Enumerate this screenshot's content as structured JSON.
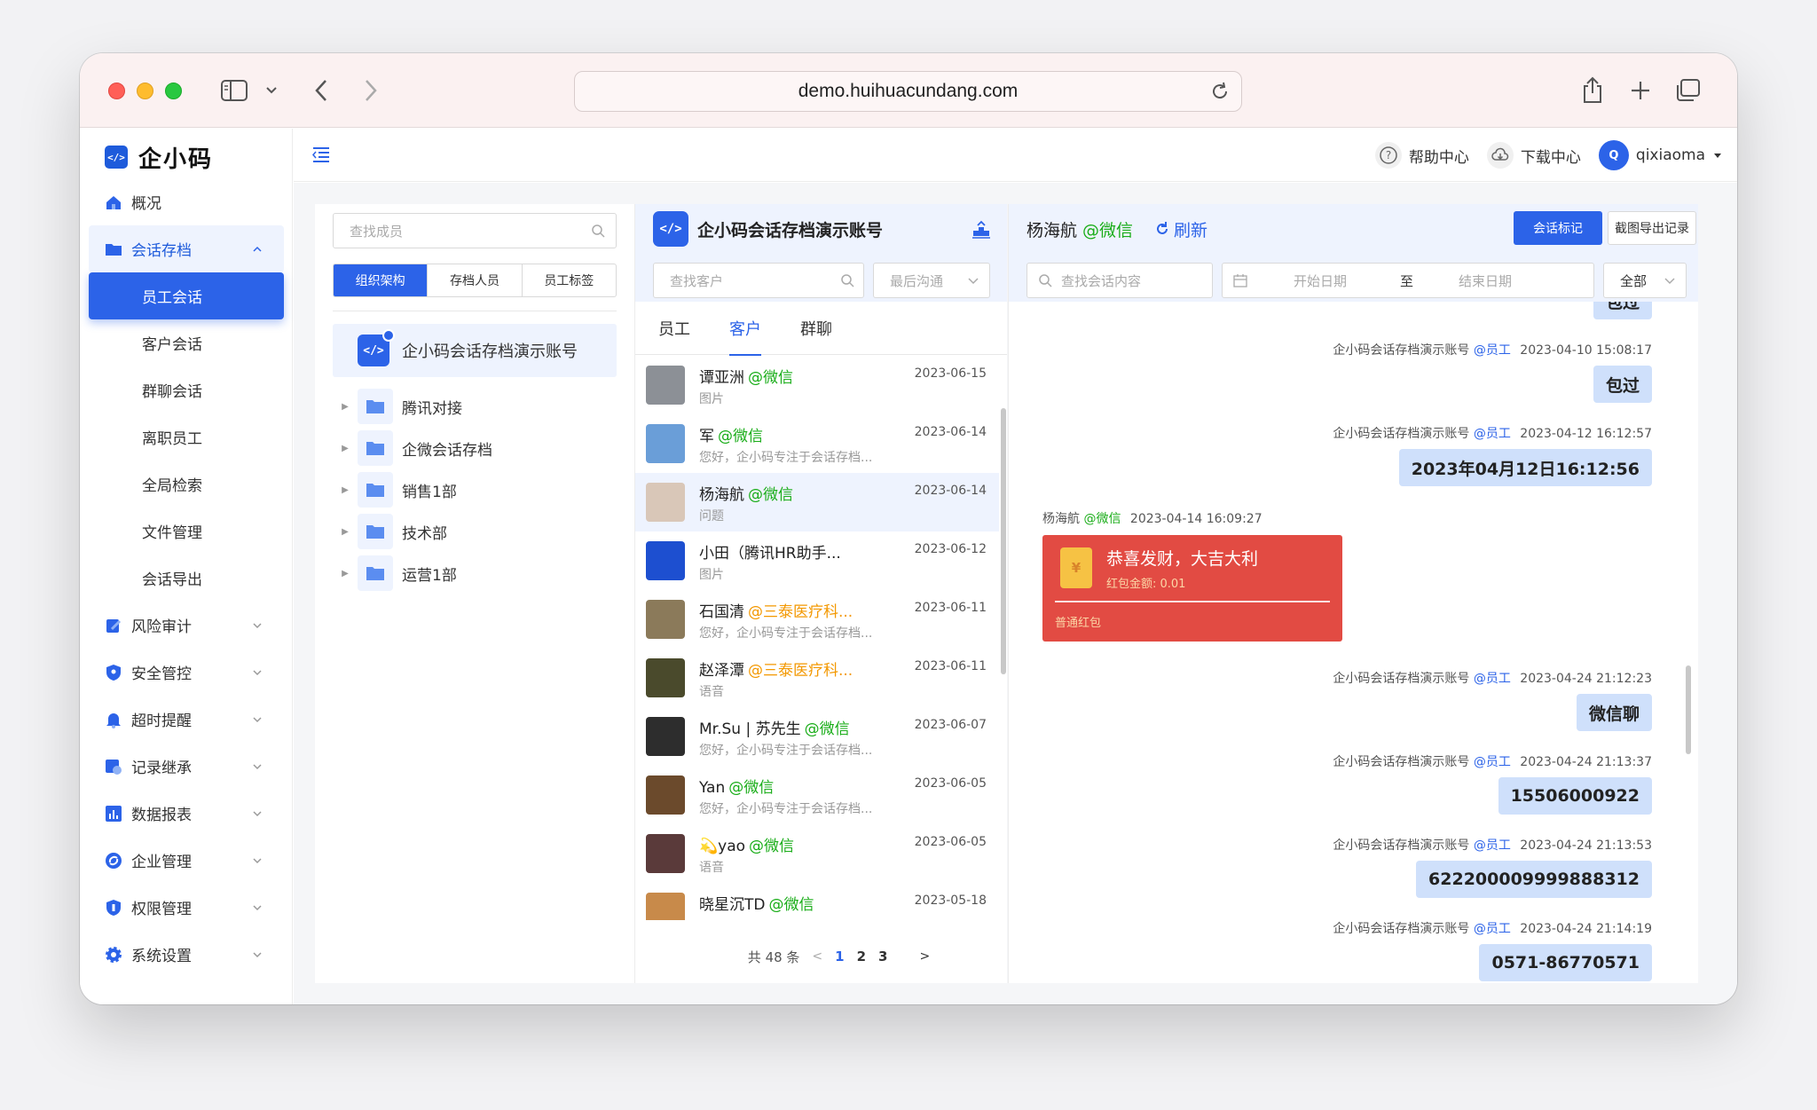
{
  "browser": {
    "url": "demo.huihuacundang.com"
  },
  "app": {
    "logo_text": "企小码"
  },
  "sidebar": {
    "items": [
      {
        "label": "概况",
        "icon": "home-icon"
      },
      {
        "label": "会话存档",
        "icon": "folder-icon",
        "open": true
      },
      {
        "label": "风险审计",
        "icon": "audit-icon"
      },
      {
        "label": "安全管控",
        "icon": "shield-icon"
      },
      {
        "label": "超时提醒",
        "icon": "bell-icon"
      },
      {
        "label": "记录继承",
        "icon": "inherit-icon"
      },
      {
        "label": "数据报表",
        "icon": "chart-icon"
      },
      {
        "label": "企业管理",
        "icon": "enterprise-icon"
      },
      {
        "label": "权限管理",
        "icon": "permission-icon"
      },
      {
        "label": "系统设置",
        "icon": "settings-icon"
      }
    ],
    "sub_items": [
      "员工会话",
      "客户会话",
      "群聊会话",
      "离职员工",
      "全局检索",
      "文件管理",
      "会话导出"
    ]
  },
  "topbar": {
    "help": "帮助中心",
    "download": "下载中心",
    "user": "qixiaoma",
    "avatar_letter": "Q"
  },
  "col1": {
    "search_placeholder": "查找成员",
    "tabs": [
      "组织架构",
      "存档人员",
      "员工标签"
    ],
    "root": "企小码会话存档演示账号",
    "folders": [
      "腾讯对接",
      "企微会话存档",
      "销售1部",
      "技术部",
      "运营1部"
    ]
  },
  "col2": {
    "title": "企小码会话存档演示账号",
    "search_placeholder": "查找客户",
    "sort_placeholder": "最后沟通",
    "tabs": [
      "员工",
      "客户",
      "群聊"
    ],
    "chats": [
      {
        "name": "谭亚洲",
        "tag": "@微信",
        "tag_type": "wx",
        "sub": "图片",
        "date": "2023-06-15",
        "avatar": "#8c9096"
      },
      {
        "name": "军",
        "tag": "@微信",
        "tag_type": "wx",
        "sub": "您好，企小码专注于会话存档...",
        "date": "2023-06-14",
        "avatar": "#6a9ed8"
      },
      {
        "name": "杨海航",
        "tag": "@微信",
        "tag_type": "wx",
        "sub": "问题",
        "date": "2023-06-14",
        "avatar": "#d9c7b8",
        "selected": true
      },
      {
        "name": "小田（腾讯HR助手...",
        "tag": "",
        "tag_type": "wx",
        "sub": "图片",
        "date": "2023-06-12",
        "avatar": "#1d4fd0"
      },
      {
        "name": "石国清",
        "tag": "@三泰医疗科...",
        "tag_type": "corp",
        "sub": "您好，企小码专注于会话存档...",
        "date": "2023-06-11",
        "avatar": "#8b7a5a"
      },
      {
        "name": "赵泽潭",
        "tag": "@三泰医疗科...",
        "tag_type": "corp",
        "sub": "语音",
        "date": "2023-06-11",
        "avatar": "#4a4a2c"
      },
      {
        "name": "Mr.Su | 苏先生",
        "tag": "@微信",
        "tag_type": "wx",
        "sub": "您好，企小码专注于会话存档...",
        "date": "2023-06-07",
        "avatar": "#2d2d2d"
      },
      {
        "name": "Yan",
        "tag": "@微信",
        "tag_type": "wx",
        "sub": "您好，企小码专注于会话存档...",
        "date": "2023-06-05",
        "avatar": "#6b4a2c"
      },
      {
        "name": "💫yao",
        "tag": "@微信",
        "tag_type": "wx",
        "sub": "语音",
        "date": "2023-06-05",
        "avatar": "#5a3a3a"
      },
      {
        "name": "晓星沉TD",
        "tag": "@微信",
        "tag_type": "wx",
        "sub": "",
        "date": "2023-05-18",
        "avatar": "#c88a4a"
      }
    ],
    "pager": {
      "total": "共 48 条",
      "pages": [
        "1",
        "2",
        "3"
      ],
      "current": "1"
    }
  },
  "col3": {
    "contact": "杨海航",
    "contact_tag": "@微信",
    "refresh": "刷新",
    "mark_button": "会话标记",
    "export_button": "截图导出记录",
    "search_placeholder": "查找会话内容",
    "start_date": "开始日期",
    "range_sep": "至",
    "end_date": "结束日期",
    "filter": "全部",
    "partial_top": "包过",
    "messages": [
      {
        "sender": "企小码会话存档演示账号",
        "role": "@员工",
        "time": "2023-04-10 15:08:17",
        "text": "包过"
      },
      {
        "sender": "企小码会话存档演示账号",
        "role": "@员工",
        "time": "2023-04-12 16:12:57",
        "text": "2023年04月12日16:12:56"
      },
      {
        "sender": "企小码会话存档演示账号",
        "role": "@员工",
        "time": "2023-04-24 21:12:23",
        "text": "微信聊"
      },
      {
        "sender": "企小码会话存档演示账号",
        "role": "@员工",
        "time": "2023-04-24 21:13:37",
        "text": "15506000922"
      },
      {
        "sender": "企小码会话存档演示账号",
        "role": "@员工",
        "time": "2023-04-24 21:13:53",
        "text": "6222000099998883​12"
      },
      {
        "sender": "企小码会话存档演示账号",
        "role": "@员工",
        "time": "2023-04-24 21:14:19",
        "text": "0571-86770571"
      }
    ],
    "red_packet": {
      "sender": "杨海航",
      "role": "@微信",
      "time": "2023-04-14 16:09:27",
      "title": "恭喜发财，大吉大利",
      "amount": "红包金额: 0.01",
      "type": "普通红包",
      "symbol": "¥"
    }
  }
}
